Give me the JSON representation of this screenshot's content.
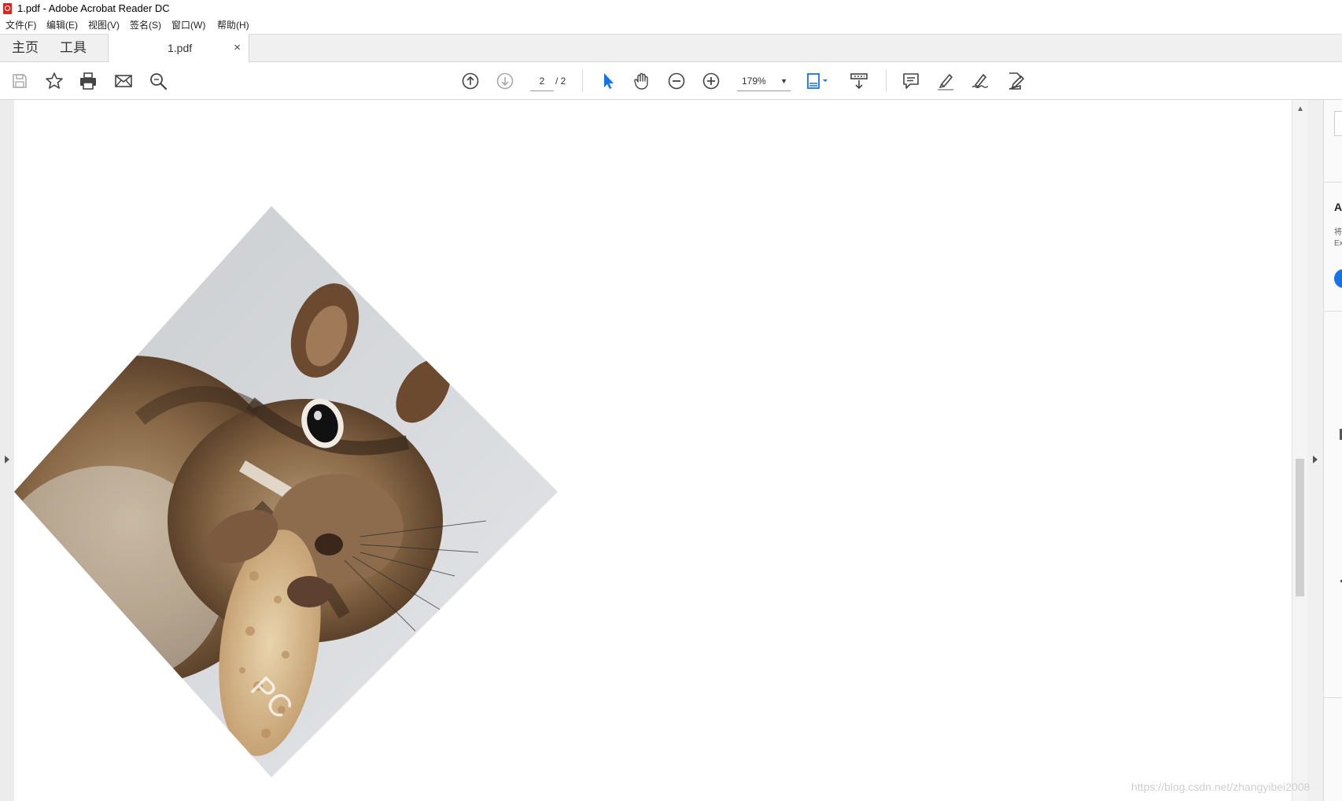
{
  "window": {
    "title": "1.pdf - Adobe Acrobat Reader DC"
  },
  "menu": {
    "items": [
      "文件(F)",
      "编辑(E)",
      "视图(V)",
      "签名(S)",
      "窗口(W)",
      "帮助(H)"
    ]
  },
  "tabs": {
    "home": "主页",
    "tools": "工具",
    "document": "1.pdf",
    "close_glyph": "×"
  },
  "toolbar": {
    "page_current": "2",
    "page_total": "/ 2",
    "zoom": "179%",
    "icons": [
      "save-icon",
      "bookmark-star-icon",
      "print-icon",
      "email-icon",
      "search-icon",
      "page-up-icon",
      "page-down-icon",
      "select-cursor-icon",
      "hand-icon",
      "zoom-out-icon",
      "zoom-in-icon",
      "fit-page-icon",
      "scroll-mode-icon",
      "comment-icon",
      "highlight-icon",
      "sign-icon",
      "fill-sign-icon"
    ],
    "accent_color": "#1473e6"
  },
  "document": {
    "image": "rotated chipmunk photo with peanut",
    "watermark_fragment": "PC"
  },
  "right_panel": {
    "fragment_a": "A",
    "fragment_b": "将",
    "fragment_c": "Ex"
  },
  "watermark": "https://blog.csdn.net/zhangyibei2008"
}
